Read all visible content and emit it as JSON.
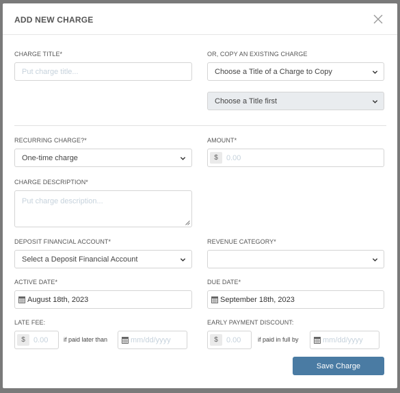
{
  "modal": {
    "title": "ADD NEW CHARGE",
    "close_icon": "close-icon"
  },
  "charge_title": {
    "label": "CHARGE TITLE*",
    "placeholder": "Put charge title..."
  },
  "copy_charge": {
    "label": "OR, COPY AN EXISTING CHARGE",
    "select_value": "Choose a Title of a Charge to Copy",
    "secondary_value": "Choose a Title first"
  },
  "recurring": {
    "label": "RECURRING CHARGE?*",
    "value": "One-time charge"
  },
  "amount": {
    "label": "AMOUNT*",
    "currency": "$",
    "placeholder": "0.00"
  },
  "description": {
    "label": "CHARGE DESCRIPTION*",
    "placeholder": "Put charge description..."
  },
  "deposit_account": {
    "label": "DEPOSIT FINANCIAL ACCOUNT*",
    "value": "Select a Deposit Financial Account"
  },
  "revenue_category": {
    "label": "REVENUE CATEGORY*",
    "value": ""
  },
  "active_date": {
    "label": "ACTIVE DATE*",
    "value": "August 18th, 2023"
  },
  "due_date": {
    "label": "DUE DATE*",
    "value": "September 18th, 2023"
  },
  "late_fee": {
    "label": "LATE FEE:",
    "currency": "$",
    "placeholder": "0.00",
    "connector": "if paid later than",
    "date_placeholder": "mm/dd/yyyy"
  },
  "early_discount": {
    "label": "EARLY PAYMENT DISCOUNT:",
    "currency": "$",
    "placeholder": "0.00",
    "connector": "if paid in full by",
    "date_placeholder": "mm/dd/yyyy"
  },
  "save_button": "Save Charge",
  "colors": {
    "primary": "#4a7ba3",
    "overlay": "#7a7a7a",
    "placeholder": "#c6d2dc"
  }
}
